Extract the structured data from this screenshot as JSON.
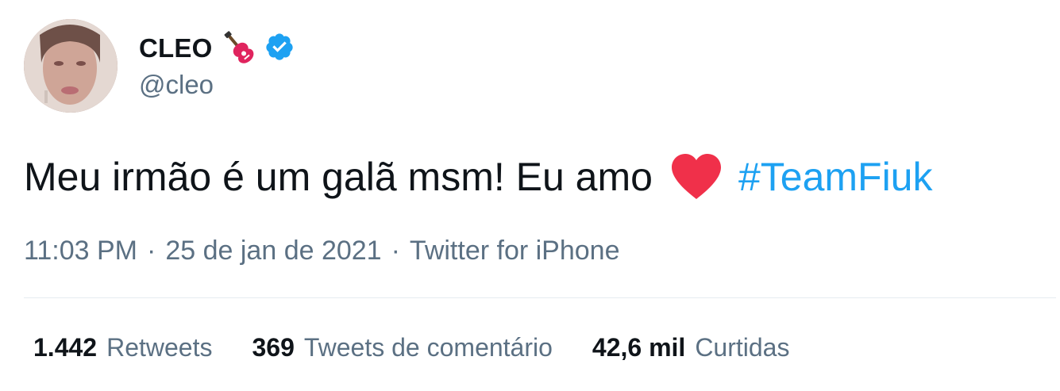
{
  "tweet": {
    "author": {
      "display_name": "CLEO",
      "name_emoji": "guitar-icon",
      "verified_badge": "verified-badge-icon",
      "handle": "@cleo"
    },
    "text_before": "Meu irmão é um galã msm! Eu amo",
    "text_emoji": "red-heart-icon",
    "hashtag": "#TeamFiuk",
    "time": "11:03 PM",
    "date": "25 de jan de 2021",
    "source": "Twitter for iPhone",
    "separator": "·",
    "stats": {
      "retweets_count": "1.442",
      "retweets_label": "Retweets",
      "quotes_count": "369",
      "quotes_label": "Tweets de comentário",
      "likes_count": "42,6 mil",
      "likes_label": "Curtidas"
    }
  },
  "colors": {
    "text": "#0f1419",
    "secondary": "#5b7083",
    "link": "#1da1f2",
    "verified": "#1da1f2",
    "heart": "#e0245e",
    "divider": "#e6ecf0"
  }
}
